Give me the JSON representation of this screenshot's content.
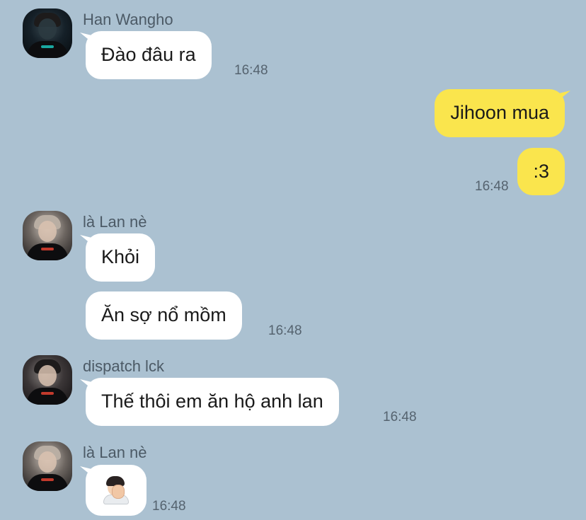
{
  "chat": {
    "messages": [
      {
        "sender": "Han Wangho",
        "text": "Đào đâu ra",
        "time": "16:48"
      },
      {
        "sender": "me",
        "text": "Jihoon mua"
      },
      {
        "sender": "me",
        "text": ":3",
        "time": "16:48"
      },
      {
        "sender": "là Lan nè",
        "text": "Khỏi"
      },
      {
        "sender": "là Lan nè",
        "text": "Ăn sợ nổ mồm",
        "time": "16:48"
      },
      {
        "sender": "dispatch lck",
        "text": "Thế thôi em ăn hộ anh lan",
        "time": "16:48"
      },
      {
        "sender": "là Lan nè",
        "emoji": "face-palm-emoji",
        "time": "16:48"
      }
    ]
  },
  "colors": {
    "background": "#abc1d1",
    "incoming_bubble": "#ffffff",
    "outgoing_bubble": "#fae54d"
  }
}
